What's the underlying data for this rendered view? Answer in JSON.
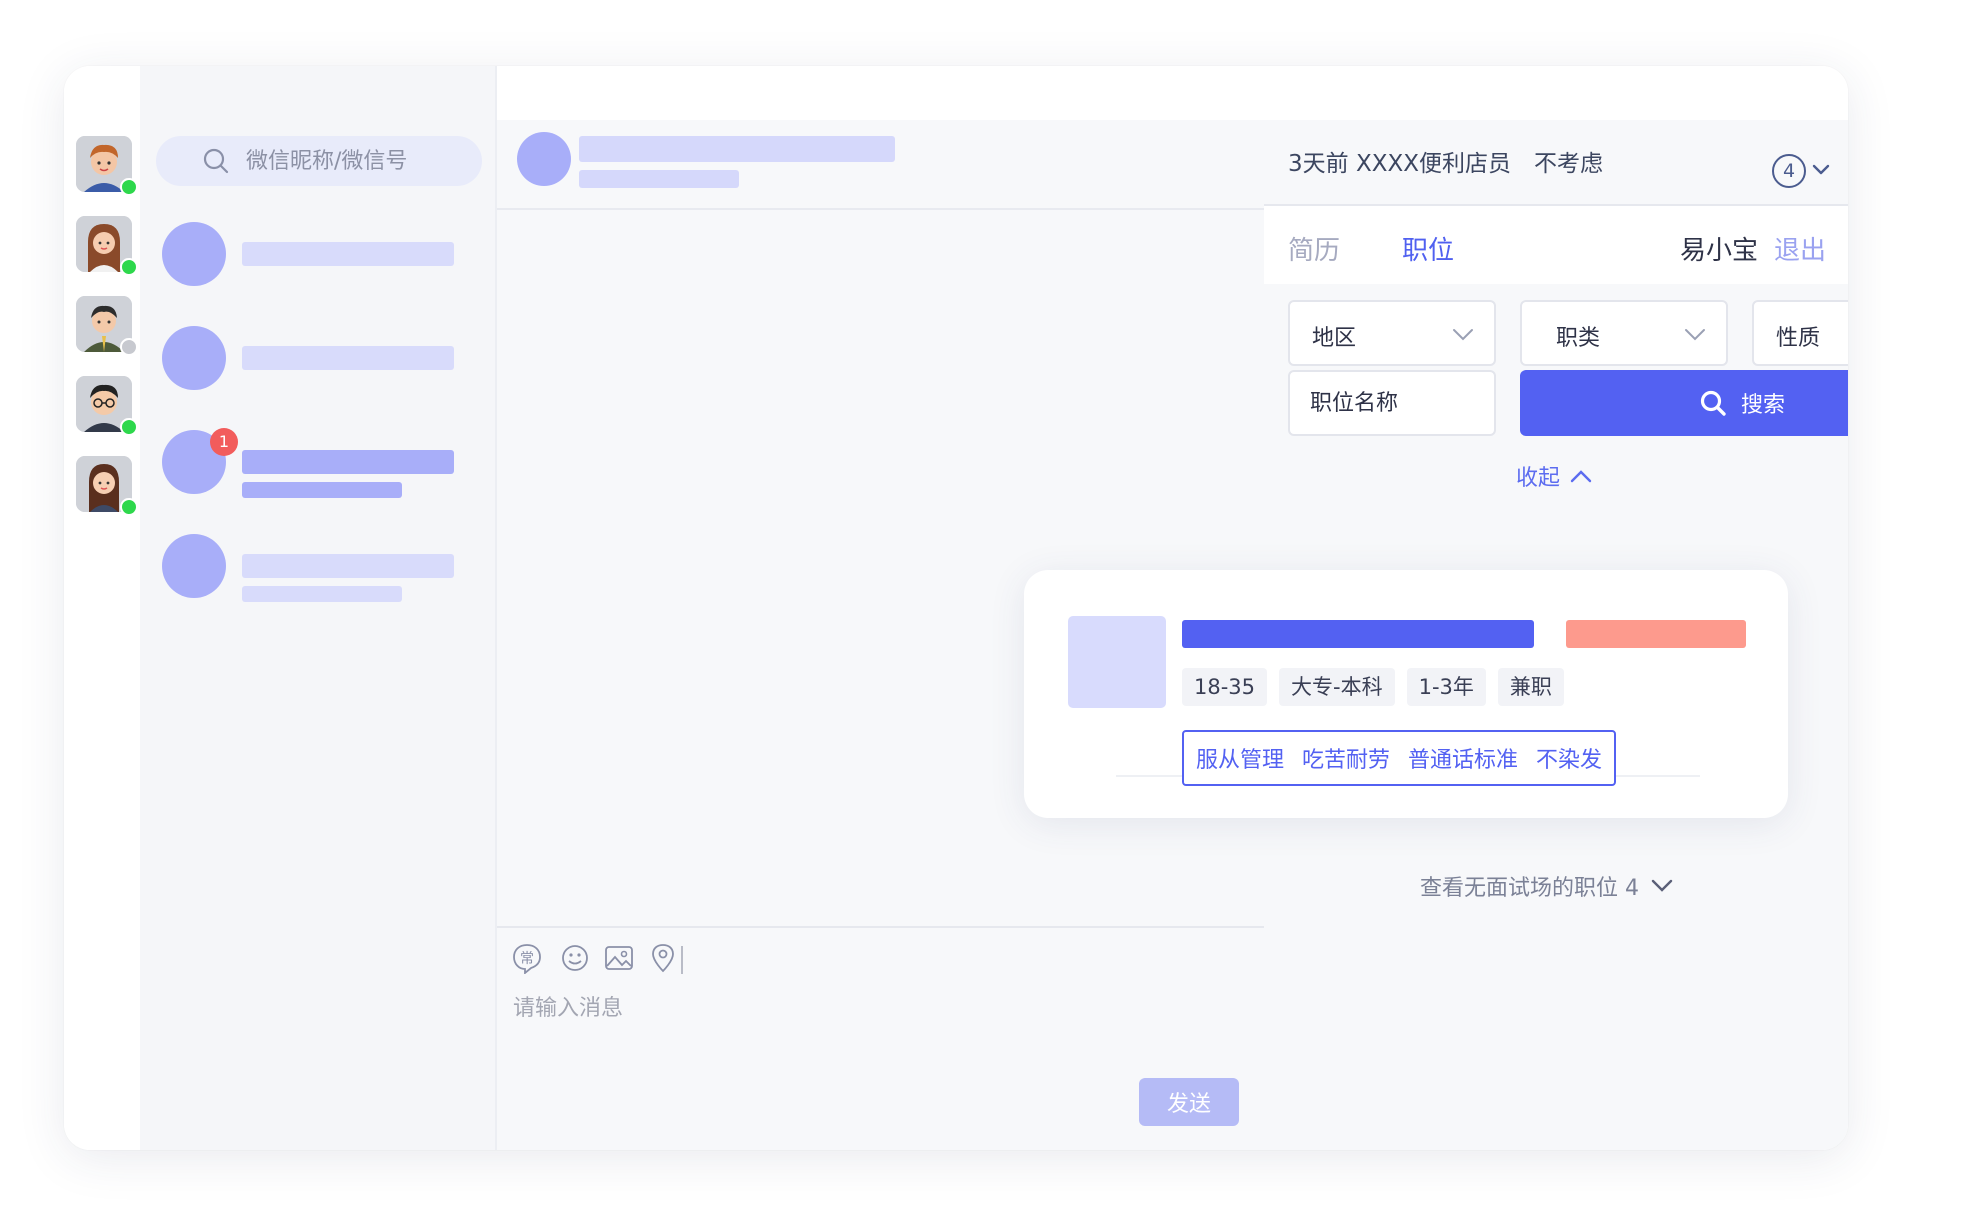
{
  "window": {
    "traffic_lights": [
      "close",
      "minimize",
      "maximize"
    ]
  },
  "rail": {
    "avatars": [
      {
        "name": "avatar-man-brown-hair",
        "online": true
      },
      {
        "name": "avatar-woman-long-hair",
        "online": true
      },
      {
        "name": "avatar-man-suit",
        "online": false
      },
      {
        "name": "avatar-man-glasses",
        "online": true
      },
      {
        "name": "avatar-woman-dark-hair",
        "online": true
      }
    ]
  },
  "contacts": {
    "search_placeholder": "微信昵称/微信号",
    "items": [
      {
        "unread": 0
      },
      {
        "unread": 0
      },
      {
        "unread": "1"
      },
      {
        "unread": 0
      }
    ]
  },
  "composer": {
    "tools": [
      "common-phrases-icon",
      "emoji-icon",
      "image-icon",
      "location-icon"
    ],
    "common_glyph": "常",
    "placeholder": "请输入消息",
    "send_label": "发送"
  },
  "panel": {
    "status_text": "3天前 XXXX便利店员　不考虑",
    "count": "4",
    "tabs": {
      "resume": "简历",
      "job": "职位"
    },
    "user_name": "易小宝",
    "logout": "退出",
    "filters": {
      "region": "地区",
      "category": "职类",
      "nature": "性质",
      "job_name_placeholder": "职位名称",
      "search_label": "搜索",
      "collapse_label": "收起"
    },
    "more_label": "查看无面试场的职位 4"
  },
  "job_card": {
    "tags": [
      "18-35",
      "大专-本科",
      "1-3年",
      "兼职"
    ],
    "benefits": [
      "服从管理",
      "吃苦耐劳",
      "普通话标准",
      "不染发"
    ]
  },
  "colors": {
    "accent": "#5361f2",
    "accent_light": "#a8aef9",
    "salary": "#fd9a8d",
    "badge": "#f25c5c",
    "online": "#2ed84c"
  }
}
